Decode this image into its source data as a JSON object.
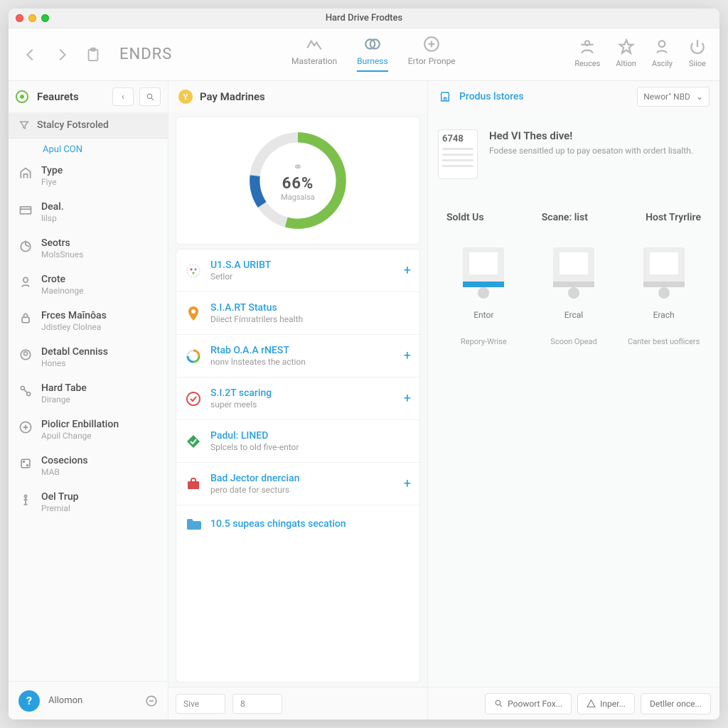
{
  "window": {
    "title": "Hard Drive Frodtes"
  },
  "toolbar": {
    "brand": "ENDRS",
    "tabs_center": [
      {
        "label": "Masteration"
      },
      {
        "label": "Burness"
      },
      {
        "label": "Ertor Pronpe"
      }
    ],
    "tabs_right": [
      {
        "label": "Reuces"
      },
      {
        "label": "Altion"
      },
      {
        "label": "Ascily"
      },
      {
        "label": "Siioe"
      }
    ]
  },
  "sidebar": {
    "title": "Feaurets",
    "section_label": "Stalcy Fotsroled",
    "section_link": "Apul CON",
    "items": [
      {
        "title": "Type",
        "sub": "Fiye"
      },
      {
        "title": "Deal.",
        "sub": "lilsp"
      },
      {
        "title": "Seotrs",
        "sub": "MolsSnues"
      },
      {
        "title": "Crote",
        "sub": "Maeinonge"
      },
      {
        "title": "Frces Maīnôas",
        "sub": "Jdistley Clolnea"
      },
      {
        "title": "Detabl Cenniss",
        "sub": "Hones"
      },
      {
        "title": "Hard Tabe",
        "sub": "Dirange"
      },
      {
        "title": "Piolicr Enbillation",
        "sub": "Apuil Change"
      },
      {
        "title": "Cosecions",
        "sub": "MAB"
      },
      {
        "title": "Oel Trup",
        "sub": "Premial"
      }
    ],
    "footer_label": "Allomon"
  },
  "mid": {
    "title": "Pay Madrines",
    "donut": {
      "percent": "66%",
      "label": "Magsalsa"
    },
    "cards": [
      {
        "title": "U1.S.A URIBT",
        "sub": "Setlor",
        "plus": true,
        "icon": "dots"
      },
      {
        "title": "S.I.A.RT Status",
        "sub": "Diiect Fímratrilers health",
        "plus": false,
        "icon": "pin"
      },
      {
        "title": "Rtab O.A.A rNEST",
        "sub": "nonv lnsteates the action",
        "plus": true,
        "icon": "ring"
      },
      {
        "title": "S.I.2T scaring",
        "sub": "super meels",
        "plus": true,
        "icon": "check"
      },
      {
        "title": "Padul: LINED",
        "sub": "Splcels to old five-entor",
        "plus": false,
        "icon": "diamond"
      },
      {
        "title": "Bad Jector dnercian",
        "sub": "pero date for secturs",
        "plus": true,
        "icon": "case"
      },
      {
        "title": "10.5 supeas chingats secation",
        "sub": "",
        "plus": false,
        "icon": "folder"
      }
    ],
    "footer": {
      "label": "Sive",
      "value": "8"
    }
  },
  "right": {
    "title": "Produs lstores",
    "dropdown": "Newor\" NBD",
    "promo": {
      "thumb_num": "6748",
      "title": "Hed VI Thes dive!",
      "sub": "Fodese sensitled up to pay oesaton with ordert lisalth."
    },
    "col_headers": [
      "Soldt Us",
      "Scane: list",
      "Host Tryrlire"
    ],
    "icons": [
      {
        "cap": "Entor",
        "sub": "Repory-Wrise",
        "active": true
      },
      {
        "cap": "Ercal",
        "sub": "Scoon Opead",
        "active": false
      },
      {
        "cap": "Erach",
        "sub": "Canter best uoflicers",
        "active": false
      }
    ],
    "footer": {
      "btn1": "Poowort Fox...",
      "btn2": "Inper...",
      "btn3": "Detller once..."
    }
  }
}
